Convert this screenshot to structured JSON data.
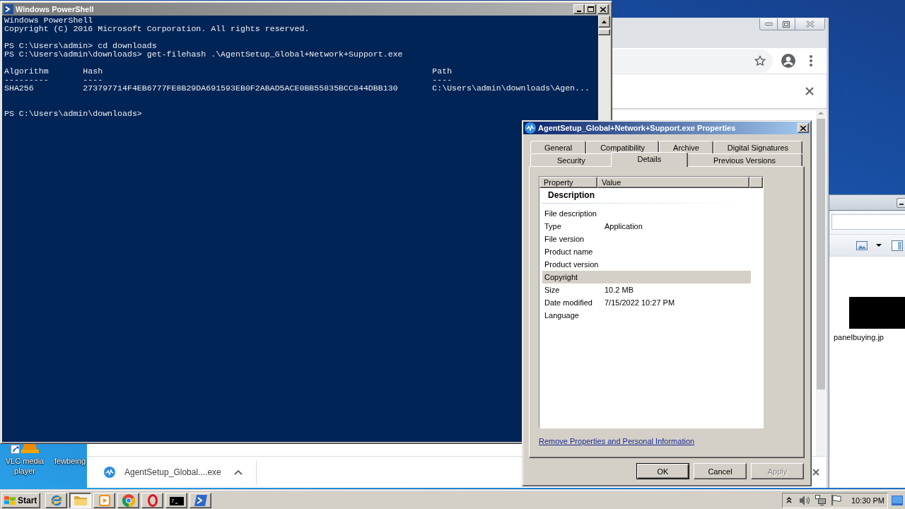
{
  "powershell": {
    "title": "Windows PowerShell",
    "active": false,
    "blocks": [
      {
        "kind": "text",
        "lines": [
          "Windows PowerShell",
          "Copyright (C) 2016 Microsoft Corporation. All rights reserved."
        ]
      },
      {
        "kind": "text",
        "lines": [
          "PS C:\\Users\\admin> cd downloads",
          "PS C:\\Users\\admin\\downloads> get-filehash .\\AgentSetup_Global+Network+Support.exe"
        ]
      },
      {
        "kind": "table",
        "columns": [
          "Algorithm",
          "Hash",
          "Path"
        ],
        "rules": [
          "---------",
          "----",
          "----"
        ],
        "rows": [
          [
            "SHA256",
            "273797714F4EB6777FE8B29DA691593EB0F2ABAD5ACE0BB55835BCC844DBB130",
            "C:\\Users\\admin\\downloads\\Agen..."
          ]
        ]
      },
      {
        "kind": "text",
        "lines": [
          "PS C:\\Users\\admin\\downloads>"
        ]
      }
    ]
  },
  "desktop_icons": [
    {
      "label": "VLC media player"
    },
    {
      "label": "fewbeing"
    }
  ],
  "browser": {
    "downloads": [
      {
        "file": "AgentSetup_Global....exe"
      }
    ]
  },
  "explorer": {
    "files": [
      {
        "name": "panelbuying.jp"
      }
    ]
  },
  "properties_dialog": {
    "title": "AgentSetup_Global+Network+Support.exe Properties",
    "active": true,
    "tab_rows": [
      {
        "tabs": [
          {
            "label": "General",
            "selected": false
          },
          {
            "label": "Compatibility",
            "selected": false
          },
          {
            "label": "Archive",
            "selected": false
          },
          {
            "label": "Digital Signatures",
            "selected": false
          }
        ]
      },
      {
        "tabs": [
          {
            "label": "Security",
            "selected": false
          },
          {
            "label": "Details",
            "selected": true
          },
          {
            "label": "Previous Versions",
            "selected": false
          }
        ]
      }
    ],
    "columns": [
      "Property",
      "Value"
    ],
    "group": "Description",
    "rows": [
      {
        "property": "File description",
        "selected": false
      },
      {
        "property": "Type",
        "value": "Application",
        "selected": false
      },
      {
        "property": "File version",
        "selected": false
      },
      {
        "property": "Product name",
        "selected": false
      },
      {
        "property": "Product version",
        "selected": false
      },
      {
        "property": "Copyright",
        "selected": true
      },
      {
        "property": "Size",
        "value": "10.2 MB",
        "selected": false
      },
      {
        "property": "Date modified",
        "value": "7/15/2022 10:27 PM",
        "selected": false
      },
      {
        "property": "Language",
        "selected": false
      }
    ],
    "link": "Remove Properties and Personal Information",
    "buttons": [
      {
        "label": "OK",
        "default": true,
        "disabled": false
      },
      {
        "label": "Cancel",
        "default": false,
        "disabled": false
      },
      {
        "label": "Apply",
        "default": false,
        "disabled": true
      }
    ]
  },
  "taskbar": {
    "start": "Start",
    "buttons": [
      {
        "selected": false
      },
      {
        "selected": true
      },
      {
        "selected": false
      },
      {
        "selected": false
      },
      {
        "selected": false
      },
      {
        "selected": false
      },
      {
        "selected": false
      }
    ],
    "clock": "10:30 PM"
  }
}
